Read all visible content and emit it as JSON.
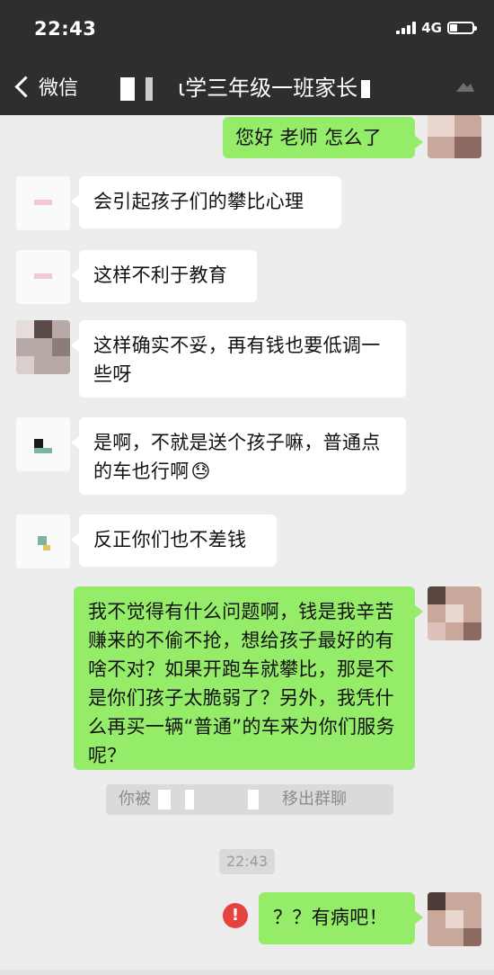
{
  "status_bar": {
    "time": "22:43",
    "network": "4G",
    "battery_level": 0.3
  },
  "nav": {
    "back_label": "微信",
    "title": "小学三年级一班家长群",
    "title_visible_text": "ι学三年级一班家长"
  },
  "messages": [
    {
      "side": "right",
      "text": "您好 老师 怎么了"
    },
    {
      "side": "left",
      "text": "会引起孩子们的攀比心理"
    },
    {
      "side": "left",
      "text": "这样不利于教育"
    },
    {
      "side": "left",
      "text": "这样确实不妥，再有钱也要低调一些呀"
    },
    {
      "side": "left",
      "text": "是啊，不就是送个孩子嘛，普通点的车也行啊",
      "emoji": "😓"
    },
    {
      "side": "left",
      "text": "反正你们也不差钱"
    },
    {
      "side": "right",
      "text": "我不觉得有什么问题啊，钱是我辛苦赚来的不偷不抢，想给孩子最好的有啥不对？如果开跑车就攀比，那是不是你们孩子太脆弱了？另外，我凭什么再买一辆“普通”的车来为你们服务呢？"
    },
    {
      "side": "right",
      "text": "？？有病吧！",
      "failed": true
    }
  ],
  "system_notice": {
    "prefix": "你被",
    "suffix": "移出群聊"
  },
  "timestamp": "22:43",
  "icons": {
    "back": "chevron-left-icon",
    "failed": "exclamation-icon"
  },
  "colors": {
    "nav_bg": "#2e2e30",
    "chat_bg": "#ededed",
    "bubble_self": "#95ec69",
    "bubble_other": "#ffffff",
    "error_red": "#e64340"
  }
}
